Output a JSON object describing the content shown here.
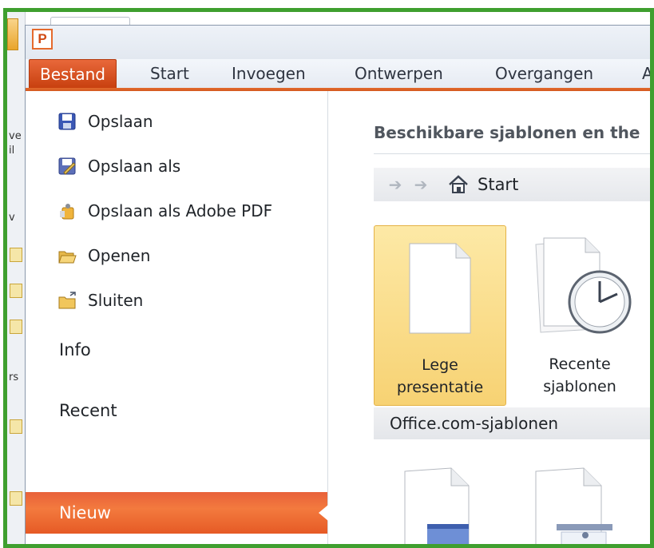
{
  "app": {
    "name": "PowerPoint",
    "logo_letter": "P"
  },
  "ribbon": {
    "tabs": [
      {
        "label": "Bestand",
        "active": true
      },
      {
        "label": "Start"
      },
      {
        "label": "Invoegen"
      },
      {
        "label": "Ontwerpen"
      },
      {
        "label": "Overgangen"
      },
      {
        "label": "An"
      }
    ]
  },
  "backstage": {
    "commands": [
      {
        "label": "Opslaan",
        "icon": "save-icon"
      },
      {
        "label": "Opslaan als",
        "icon": "save-as-icon"
      },
      {
        "label": "Opslaan als Adobe PDF",
        "icon": "pdf-icon"
      },
      {
        "label": "Openen",
        "icon": "open-folder-icon"
      },
      {
        "label": "Sluiten",
        "icon": "close-folder-icon"
      }
    ],
    "nav": [
      {
        "label": "Info"
      },
      {
        "label": "Recent"
      },
      {
        "label": "Nieuw",
        "active": true
      }
    ]
  },
  "content": {
    "title": "Beschikbare sjablonen en the",
    "breadcrumb": {
      "label": "Start"
    },
    "tiles": [
      {
        "label_line1": "Lege",
        "label_line2": "presentatie",
        "selected": true
      },
      {
        "label_line1": "Recente",
        "label_line2": "sjablonen"
      }
    ],
    "section": "Office.com-sjablonen"
  },
  "colors": {
    "accent": "#d9541f",
    "frame": "#3f9f2f",
    "selected_tile": "#f7d273"
  }
}
